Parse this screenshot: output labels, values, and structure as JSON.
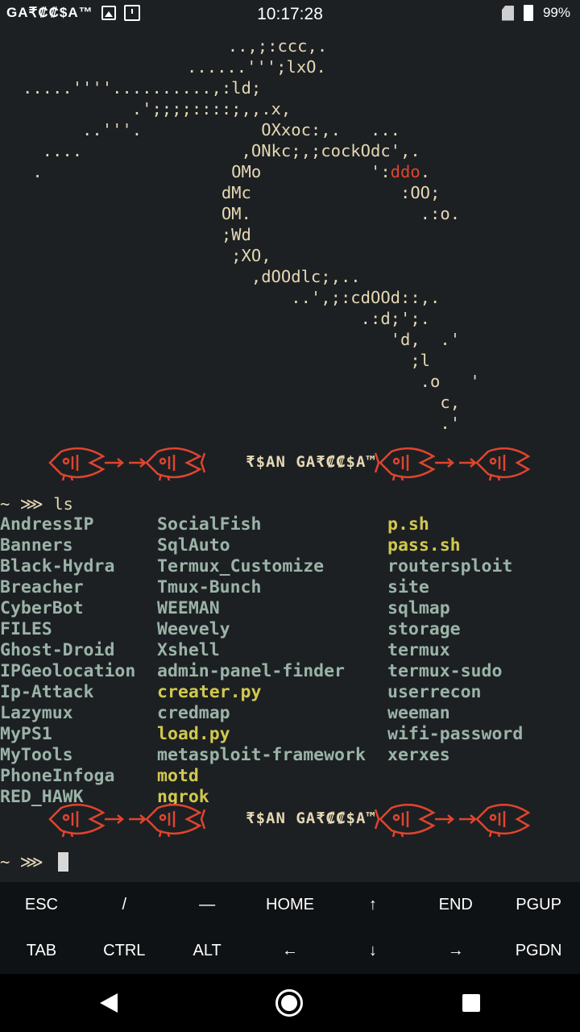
{
  "status_bar": {
    "carrier": "GA₹₡₡$A™",
    "time": "10:17:28",
    "battery": "99%"
  },
  "ascii_art": [
    "        ..,;:ccc,.",
    "      ......''';lxO.",
    ".....''''..........,:ld;",
    "           .';;;;::::;,,.x,",
    "      ..'''.            OXxoc:,.   ...",
    "  ....                ,ONkc;,;cockOdc',.",
    " .                   OMo           ':",
    "                    dMc               :OO;",
    "                    OM.                 .:o.",
    "                    ;Wd",
    "                     ;XO,",
    "                       ,dOOdlc;,..",
    "                           ..',;:cdOOd::,.",
    "                                  .:d;';.",
    "                                     'd,  .'",
    "                                       ;l",
    "                                        .o   '",
    "                                          c,",
    "                                          .'"
  ],
  "ascii_red_part": "ddo",
  "ascii_after_red": ".",
  "banner_text": "₹$AN GA₹₡₡$A™",
  "prompt_symbol": "~ ⋙ ",
  "command": "ls",
  "ls_output": {
    "col1": [
      "AndressIP",
      "Banners",
      "Black-Hydra",
      "Breacher",
      "CyberBot",
      "FILES",
      "Ghost-Droid",
      "IPGeolocation",
      "Ip-Attack",
      "Lazymux",
      "MyPS1",
      "MyTools",
      "PhoneInfoga",
      "RED_HAWK"
    ],
    "col2": [
      {
        "name": "SocialFish",
        "kind": "dir"
      },
      {
        "name": "SqlAuto",
        "kind": "dir"
      },
      {
        "name": "Termux_Customize",
        "kind": "dir"
      },
      {
        "name": "Tmux-Bunch",
        "kind": "dir"
      },
      {
        "name": "WEEMAN",
        "kind": "dir"
      },
      {
        "name": "Weevely",
        "kind": "dir"
      },
      {
        "name": "Xshell",
        "kind": "dir"
      },
      {
        "name": "admin-panel-finder",
        "kind": "dir"
      },
      {
        "name": "creater.py",
        "kind": "exe"
      },
      {
        "name": "credmap",
        "kind": "dir"
      },
      {
        "name": "load.py",
        "kind": "exe"
      },
      {
        "name": "metasploit-framework",
        "kind": "dir"
      },
      {
        "name": "motd",
        "kind": "exe"
      },
      {
        "name": "ngrok",
        "kind": "exe"
      }
    ],
    "col3": [
      {
        "name": "p.sh",
        "kind": "exe"
      },
      {
        "name": "pass.sh",
        "kind": "exe"
      },
      {
        "name": "routersploit",
        "kind": "dir"
      },
      {
        "name": "site",
        "kind": "dir"
      },
      {
        "name": "sqlmap",
        "kind": "dir"
      },
      {
        "name": "storage",
        "kind": "dir"
      },
      {
        "name": "termux",
        "kind": "dir"
      },
      {
        "name": "termux-sudo",
        "kind": "dir"
      },
      {
        "name": "userrecon",
        "kind": "dir"
      },
      {
        "name": "weeman",
        "kind": "dir"
      },
      {
        "name": "wifi-password",
        "kind": "dir"
      },
      {
        "name": "xerxes",
        "kind": "dir"
      }
    ]
  },
  "extra_keys": {
    "row1": [
      "ESC",
      "/",
      "—",
      "HOME",
      "↑",
      "END",
      "PGUP"
    ],
    "row2": [
      "TAB",
      "CTRL",
      "ALT",
      "←",
      "↓",
      "→",
      "PGDN"
    ]
  },
  "colors": {
    "background": "#1c2023",
    "foreground": "#e6d8b4",
    "directory": "#9bb3a7",
    "executable": "#d2c84e",
    "accent_red": "#e0442e"
  }
}
